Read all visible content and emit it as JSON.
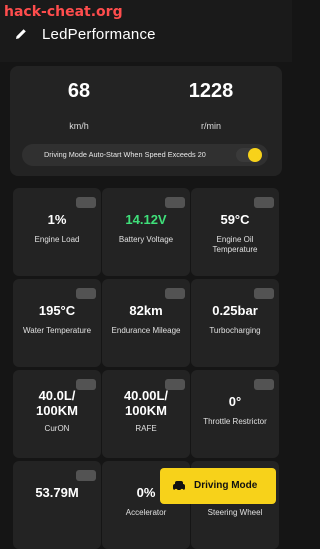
{
  "watermark": "hack-cheat.org",
  "header": {
    "title": "LedPerformance",
    "edit_icon": "pencil-icon"
  },
  "speed_panel": {
    "speed_value": "68",
    "speed_unit": "km/h",
    "rpm_value": "1228",
    "rpm_unit": "r/min",
    "auto_start_text": "Driving Mode Auto-Start When Speed Exceeds 20",
    "auto_start_enabled": true
  },
  "metrics": [
    {
      "value": "1%",
      "label": "Engine Load",
      "icon": "engine-icon"
    },
    {
      "value": "14.12V",
      "label": "Battery Voltage",
      "icon": "battery-icon",
      "value_color": "#3fe07a"
    },
    {
      "value": "59°C",
      "label": "Engine Oil Temperature",
      "icon": "oil-icon"
    },
    {
      "value": "195°C",
      "label": "Water Temperature",
      "icon": "thermometer-icon"
    },
    {
      "value": "82km",
      "label": "Endurance Mileage",
      "icon": "fuel-icon"
    },
    {
      "value": "0.25bar",
      "label": "Turbocharging",
      "icon": "turbo-icon"
    },
    {
      "value": "40.0L/ 100KM",
      "label": "CurON",
      "icon": "fuel-icon"
    },
    {
      "value": "40.00L/ 100KM",
      "label": "RAFE",
      "icon": "fuel-icon"
    },
    {
      "value": "0°",
      "label": "Throttle Restrictor",
      "icon": "throttle-icon"
    },
    {
      "value": "53.79M",
      "label": "",
      "icon": "distance-icon"
    },
    {
      "value": "0%",
      "label": "Accelerator",
      "icon": "pedal-icon"
    },
    {
      "value": "",
      "label": "Steering Wheel",
      "icon": "steering-icon"
    }
  ],
  "driving_mode_button": {
    "label": "Driving Mode",
    "icon": "car-icon"
  },
  "colors": {
    "accent": "#f7d21a",
    "card": "#232323",
    "background": "#151515"
  }
}
